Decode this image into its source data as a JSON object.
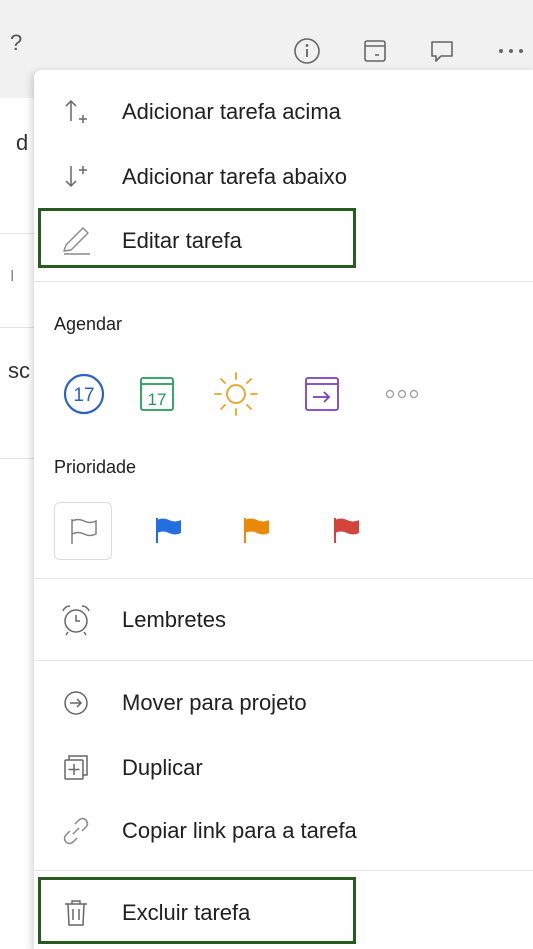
{
  "background": {
    "topbar_fragment": "?",
    "fragments": [
      "d",
      "I",
      "sc"
    ],
    "icons": [
      "info-icon",
      "sidebar-panel-icon",
      "comment-icon",
      "more-icon"
    ]
  },
  "menu": {
    "items_top": [
      {
        "label": "Adicionar tarefa acima",
        "icon": "arrow-up-plus-icon"
      },
      {
        "label": "Adicionar tarefa abaixo",
        "icon": "arrow-down-plus-icon"
      },
      {
        "label": "Editar tarefa",
        "icon": "pencil-icon",
        "highlighted": true
      }
    ],
    "schedule": {
      "label": "Agendar",
      "today_day": "17",
      "tomorrow_day": "17",
      "options": [
        "today-icon",
        "tomorrow-calendar-icon",
        "weekend-sun-icon",
        "next-week-icon",
        "more-options-icon"
      ],
      "colors": {
        "today": "#2a62c9",
        "tomorrow": "#1e9e54",
        "weekend": "#f0a020",
        "next_week": "#7b3fc4",
        "more": "#999999"
      }
    },
    "priority": {
      "label": "Prioridade",
      "options": [
        "priority-none-icon",
        "priority-blue-flag-icon",
        "priority-orange-flag-icon",
        "priority-red-flag-icon"
      ],
      "colors": {
        "p1": "#d1453b",
        "p2": "#eb8909",
        "p3": "#246fe0",
        "p4": "#808080"
      }
    },
    "reminders": {
      "label": "Lembretes",
      "icon": "alarm-clock-icon"
    },
    "items_bottom": [
      {
        "label": "Mover para projeto",
        "icon": "move-arrow-circle-icon"
      },
      {
        "label": "Duplicar",
        "icon": "duplicate-icon"
      },
      {
        "label": "Copiar link para a tarefa",
        "icon": "link-icon"
      }
    ],
    "delete": {
      "label": "Excluir tarefa",
      "icon": "trash-icon",
      "highlighted": true
    },
    "highlight_color": "#285b1e"
  }
}
